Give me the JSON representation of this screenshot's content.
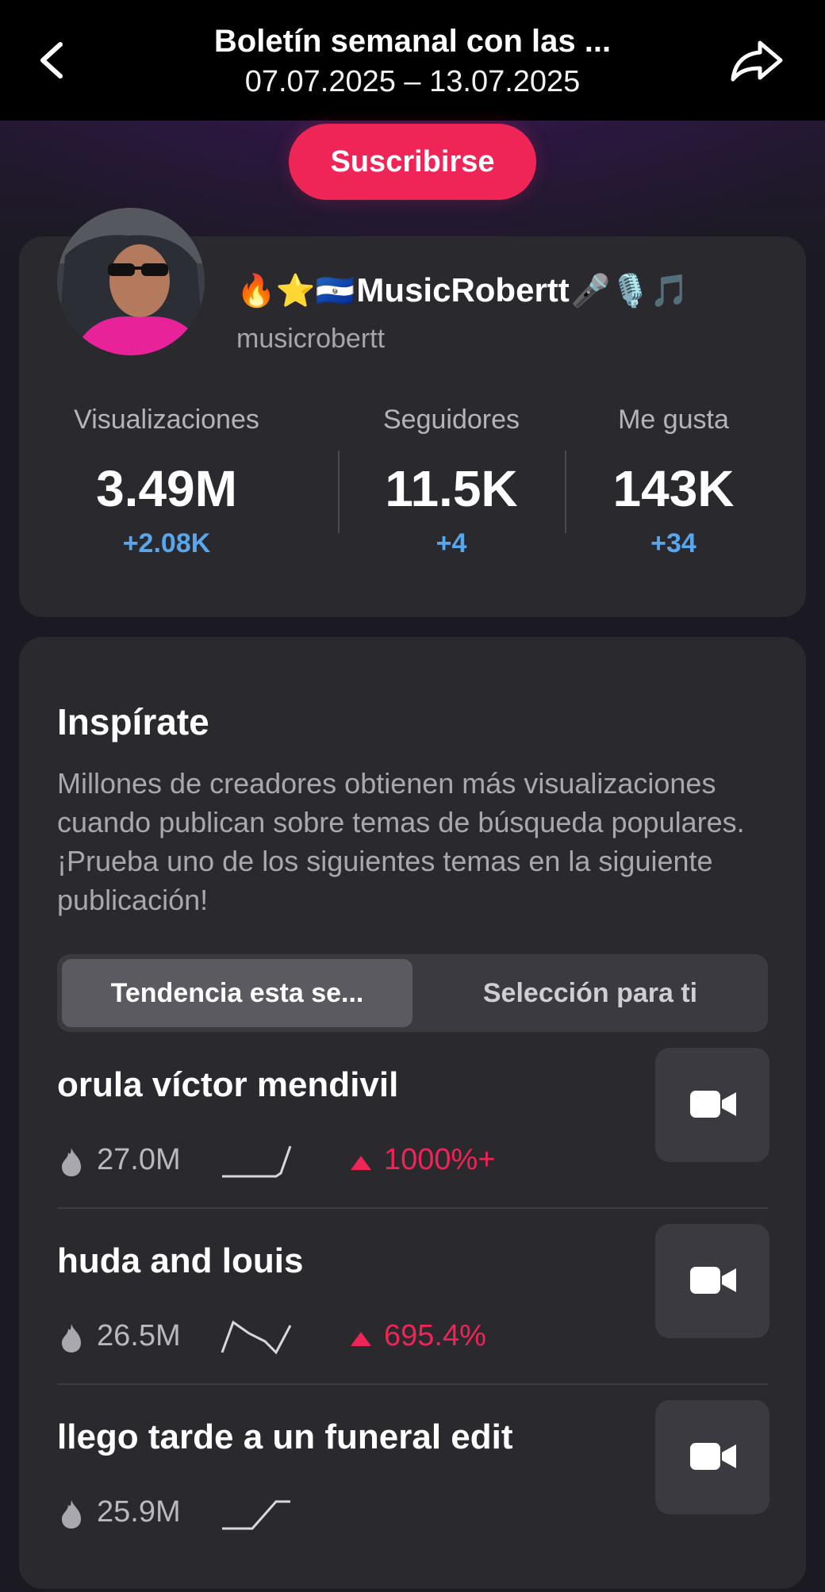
{
  "header": {
    "title": "Boletín semanal con las ...",
    "date_range": "07.07.2025 – 13.07.2025"
  },
  "subscribe_label": "Suscribirse",
  "profile": {
    "display_name": "MusicRobertt",
    "display_name_prefix_emojis": "🔥⭐🇸🇻",
    "display_name_suffix_emojis": "🎤🎙️🎵",
    "username": "musicrobertt",
    "stats": [
      {
        "label": "Visualizaciones",
        "value": "3.49M",
        "delta": "+2.08K"
      },
      {
        "label": "Seguidores",
        "value": "11.5K",
        "delta": "+4"
      },
      {
        "label": "Me gusta",
        "value": "143K",
        "delta": "+34"
      }
    ]
  },
  "inspire": {
    "title": "Inspírate",
    "description": "Millones de creadores obtienen más visualizaciones cuando publican sobre temas de búsqueda populares. ¡Prueba uno de los siguientes temas en la siguiente publicación!",
    "tabs": [
      {
        "label": "Tendencia esta se...",
        "active": true
      },
      {
        "label": "Selección para ti",
        "active": false
      }
    ],
    "topics": [
      {
        "title": "orula víctor mendivil",
        "views": "27.0M",
        "growth": "1000%+",
        "trend_shape": "flat-then-spike"
      },
      {
        "title": "huda and louis",
        "views": "26.5M",
        "growth": "695.4%",
        "trend_shape": "peak-then-dip"
      },
      {
        "title": "llego tarde a un funeral edit",
        "views": "25.9M",
        "growth": "",
        "trend_shape": "rise-then-flat"
      }
    ]
  },
  "colors": {
    "accent": "#ef2457",
    "delta_blue": "#58a6ec",
    "card": "#2a292e",
    "background": "#1b1a22"
  },
  "icons": [
    "back-arrow-icon",
    "share-icon",
    "flame-icon",
    "sparkline-icon",
    "trend-up-icon",
    "video-camera-icon"
  ]
}
